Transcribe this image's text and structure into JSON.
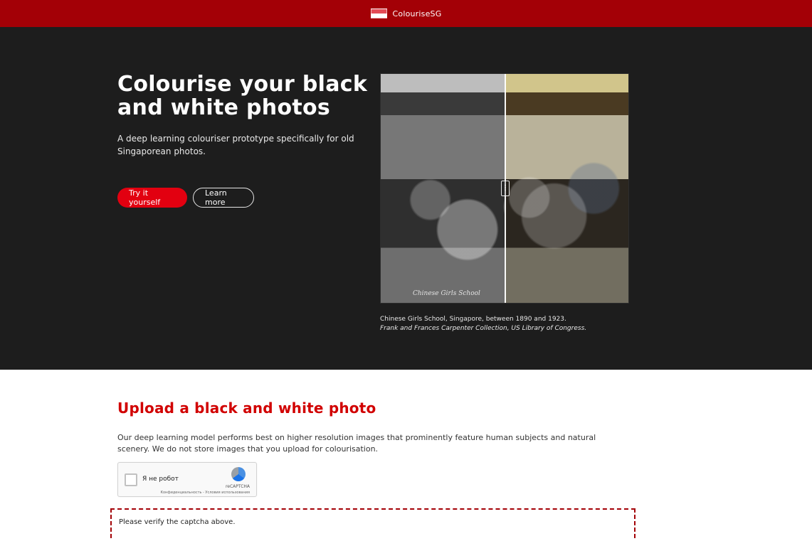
{
  "topbar": {
    "brand_name": "ColouriseSG",
    "flag_icon": "singapore-flag-icon",
    "accent_color": "#a30006"
  },
  "hero": {
    "title": "Colourise your black and white photos",
    "subtitle": "A deep learning colouriser prototype specifically for old Singaporean photos.",
    "primary_button": "Try it yourself",
    "secondary_button": "Learn more",
    "image_watermark": "Chinese Girls School",
    "caption_line1": "Chinese Girls School, Singapore, between 1890 and 1923.",
    "caption_line2": "Frank and Frances Carpenter Collection, US Library of Congress."
  },
  "upload": {
    "title": "Upload a black and white photo",
    "description": "Our deep learning model performs best on higher resolution images that prominently feature human subjects and natural scenery. We do not store images that you upload for colourisation.",
    "notice": "Please verify the captcha above."
  },
  "recaptcha": {
    "label": "Я не робот",
    "brand": "reCAPTCHA",
    "terms": "Конфиденциальность - Условия использования"
  },
  "colors": {
    "hero_bg": "#1d1d1d",
    "primary_button": "#e20010",
    "heading_red": "#d10000"
  }
}
